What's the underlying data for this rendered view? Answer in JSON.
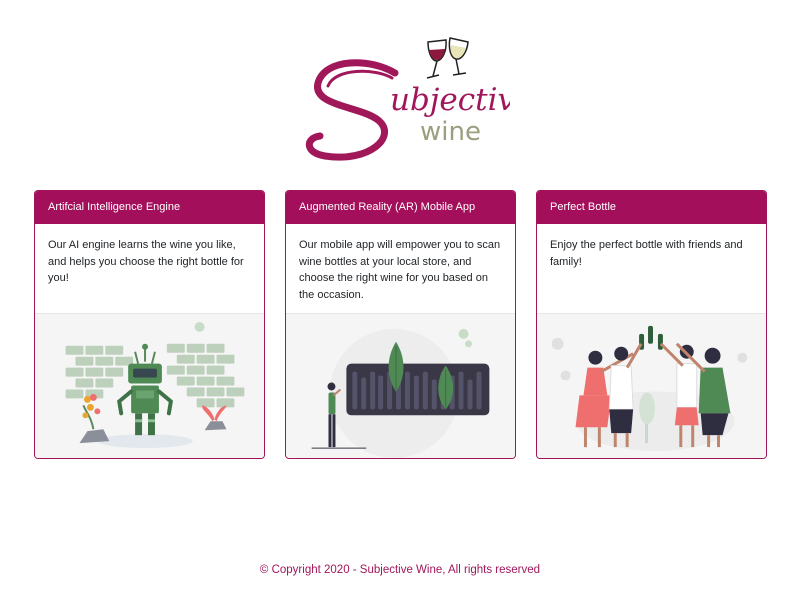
{
  "brand": {
    "name_part1": "ubjective",
    "name_part2": "wine",
    "logo_icon": "wine-glasses-icon",
    "colors": {
      "primary": "#a30f5a",
      "secondary": "#9aa07e",
      "accent_green": "#3d8f4f"
    }
  },
  "cards": [
    {
      "title": "Artifcial Intelligence Engine",
      "body": "Our AI engine learns the wine you like, and helps you choose the right bottle for you!",
      "illustration": "robot-illustration"
    },
    {
      "title": "Augmented Reality (AR) Mobile App",
      "body": "Our mobile app will empower you to scan wine bottles at your local store, and choose the right wine for you based on the occasion.",
      "illustration": "ar-scanner-illustration"
    },
    {
      "title": "Perfect Bottle",
      "body": "Enjoy the perfect bottle with friends and family!",
      "illustration": "friends-toasting-illustration"
    }
  ],
  "footer": {
    "copyright": "© Copyright 2020 - Subjective Wine, All rights reserved"
  }
}
